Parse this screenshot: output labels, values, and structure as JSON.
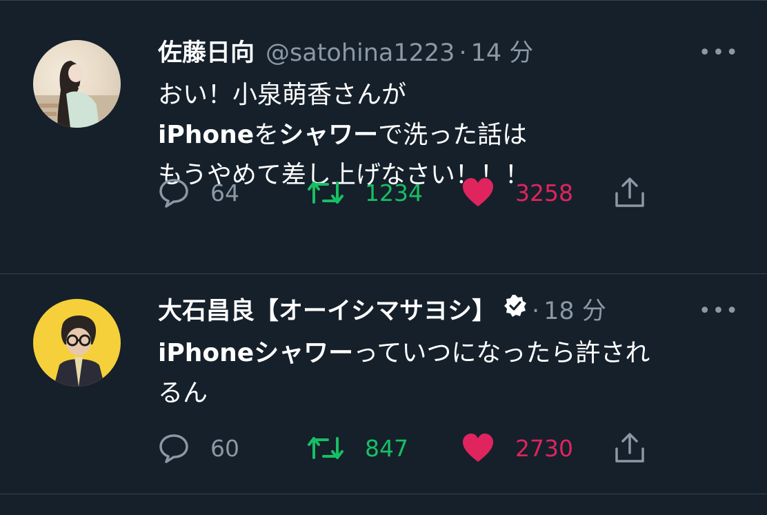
{
  "tweets": [
    {
      "name": "佐藤日向",
      "handle": "@satohina1223",
      "sep": "·",
      "time": "14 分",
      "more": "•••",
      "lines": [
        [
          {
            "t": "おい！小泉萌香さんが",
            "b": false
          }
        ],
        [
          {
            "t": "iPhone",
            "b": true
          },
          {
            "t": "を",
            "b": false
          },
          {
            "t": "シャワー",
            "b": true
          },
          {
            "t": "で洗った話は",
            "b": false
          }
        ],
        [
          {
            "t": "もうやめて差し上げなさい！！！",
            "b": false
          }
        ]
      ],
      "reply_count": "64",
      "retweet_count": "1234",
      "like_count": "3258"
    },
    {
      "name": "大石昌良【オーイシマサヨシ】",
      "handle": "",
      "sep": "·",
      "time": "18 分",
      "more": "•••",
      "lines": [
        [
          {
            "t": "iPhone",
            "b": true
          },
          {
            "t": "シャワー",
            "b": true
          },
          {
            "t": "っていつになったら許され",
            "b": false
          }
        ],
        [
          {
            "t": "るん",
            "b": false
          }
        ]
      ],
      "reply_count": "60",
      "retweet_count": "847",
      "like_count": "2730"
    }
  ],
  "icons": {
    "reply": "speech-bubble-icon",
    "retweet": "retweet-arrows-icon",
    "like": "heart-icon",
    "share": "share-upload-icon",
    "verified": "verified-badge-icon",
    "more": "more-dots-icon"
  },
  "colors": {
    "background": "#15202b",
    "muted": "#8b98a5",
    "retweet": "#17bf63",
    "like": "#e0245e",
    "divider": "#38444d"
  }
}
